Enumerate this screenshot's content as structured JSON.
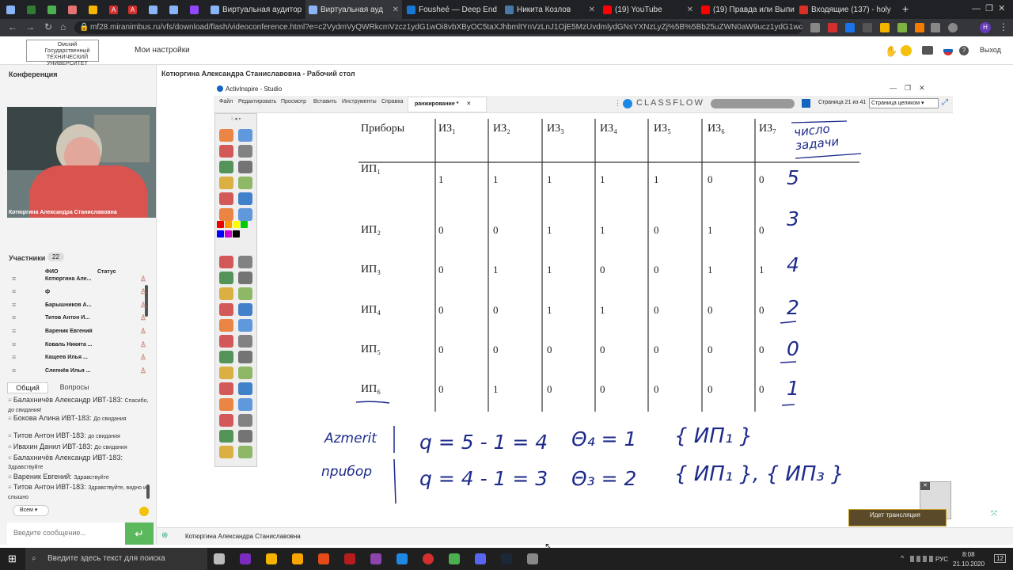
{
  "browser": {
    "tabs": [
      {
        "label": "",
        "color": "#8ab4f8"
      },
      {
        "label": "",
        "color": "#2e7d32"
      },
      {
        "label": "",
        "color": "#4caf50"
      },
      {
        "label": "",
        "color": "#e57373"
      },
      {
        "label": "",
        "color": "#f4b400"
      },
      {
        "label": "A",
        "color": "#d32f2f"
      },
      {
        "label": "A",
        "color": "#d32f2f"
      },
      {
        "label": "",
        "color": "#8ab4f8"
      },
      {
        "label": "",
        "color": "#8ab4f8"
      },
      {
        "label": "",
        "color": "#9146ff"
      },
      {
        "label": "Виртуальная аудитор",
        "color": "#8ab4f8"
      },
      {
        "label": "Виртуальная ауд",
        "color": "#8ab4f8"
      },
      {
        "label": "Fousheé — Deep End",
        "color": "#1976d2"
      },
      {
        "label": "Никита Козлов",
        "color": "#4a76a8"
      },
      {
        "label": "(19) YouTube",
        "color": "#f00"
      },
      {
        "label": "(19) Правда или Выпи",
        "color": "#f00"
      },
      {
        "label": "Входящие (137) - holy",
        "color": "#d93025"
      }
    ],
    "new_tab": "+",
    "url": "mf28.miranimbus.ru/vfs/download/flash/videoconference.html?e=c2VydmVyQWRkcmVzcz1ydG1wOi8vbXByOC5taXJhbmltYnVzLnJ1OjE5MzUvdmlydGNsYXNzLyZj%5B%5Bb25uZWN0aW9ucz1ydG1wdGmu..."
  },
  "site": {
    "logo_text": "Омский Государственный ТЕХНИЧЕСКИЙ УНИВЕРСИТЕТ",
    "settings": "Мои настройки",
    "logout": "Выход"
  },
  "left": {
    "conference": "Конференция",
    "video_name": "Котюргина Александра Станиславовна",
    "participants_label": "Участники",
    "participants_count": "22",
    "col_fio": "ФИО",
    "col_status": "Статус",
    "participants": [
      "Котюргина Але...",
      "ф",
      "Барышников А...",
      "Титов Антон И...",
      "Вареник Евгений",
      "Коваль Никита ...",
      "Кащеев Илья ...",
      "Слепнёв Илья ..."
    ],
    "tab_general": "Общий",
    "tab_questions": "Вопросы",
    "chat": [
      {
        "name": "Балахничёв Александр ИВТ-183:",
        "msg": "Спасибо, до свидания!"
      },
      {
        "name": "Бокова Алина ИВТ-183:",
        "msg": "До свидания"
      },
      {
        "name": "Титов Антон ИВТ-183:",
        "msg": "до свидания"
      },
      {
        "name": "Ивахин Данил ИВТ-183:",
        "msg": "До свидания"
      },
      {
        "name": "Балахничёв Александр ИВТ-183:",
        "msg": "Здравствуйте"
      },
      {
        "name": "Вареник Евгений:",
        "msg": "Здравствуйте"
      },
      {
        "name": "Титов Антон ИВТ-183:",
        "msg": "Здравствуйте, видно и слышно"
      }
    ],
    "recipient": "Всем",
    "input_placeholder": "Введите сообщение..."
  },
  "main": {
    "title": "Котюргина Александра Станиславовна - Рабочий стол",
    "app_title": "ActivInspire - Studio",
    "menu": [
      "Файл",
      "Редактировать",
      "Просмотр",
      "Вставить",
      "Инструменты",
      "Справка"
    ],
    "doc_tab": "ранжирование *",
    "classflow": "CLASSFLOW",
    "page_info": "Страница 21 из 41",
    "view_mode": "Страница целиком",
    "broadcast": "Идет трансляция",
    "footer_name": "Котюргина Александра Станиславовна"
  },
  "table": {
    "corner": "Приборы",
    "cols": [
      "ИЗ₁",
      "ИЗ₂",
      "ИЗ₃",
      "ИЗ₄",
      "ИЗ₅",
      "ИЗ₆",
      "ИЗ₇"
    ],
    "rows": [
      {
        "label": "ИП₁",
        "vals": [
          "1",
          "1",
          "1",
          "1",
          "1",
          "0",
          "0"
        ]
      },
      {
        "label": "ИП₂",
        "vals": [
          "0",
          "0",
          "1",
          "1",
          "0",
          "1",
          "0"
        ]
      },
      {
        "label": "ИП₃",
        "vals": [
          "0",
          "1",
          "1",
          "0",
          "0",
          "1",
          "1"
        ]
      },
      {
        "label": "ИП₄",
        "vals": [
          "0",
          "0",
          "1",
          "1",
          "0",
          "0",
          "0"
        ]
      },
      {
        "label": "ИП₅",
        "vals": [
          "0",
          "0",
          "0",
          "0",
          "0",
          "0",
          "0"
        ]
      },
      {
        "label": "ИП₆",
        "vals": [
          "0",
          "1",
          "0",
          "0",
          "0",
          "0",
          "0"
        ]
      }
    ]
  },
  "handwriting": {
    "header": "число задачи",
    "counts": [
      "5",
      "3",
      "4",
      "2",
      "0",
      "1"
    ],
    "left_note_1": "Azmerit",
    "left_note_2": "npuбop",
    "eq1": "q = 5 - 1 = 4",
    "eq2": "q = 4 - 1 = 3",
    "theta1": "Θ₄ = 1",
    "theta2": "Θ₃ = 2",
    "set1": "{ ИП₁ }",
    "set2": "{ ИП₁ }, { ИП₃ }"
  },
  "taskbar": {
    "search": "Введите здесь текст для поиска",
    "lang": "РУС",
    "time": "8:08",
    "date": "21.10.2020",
    "notif": "12"
  }
}
